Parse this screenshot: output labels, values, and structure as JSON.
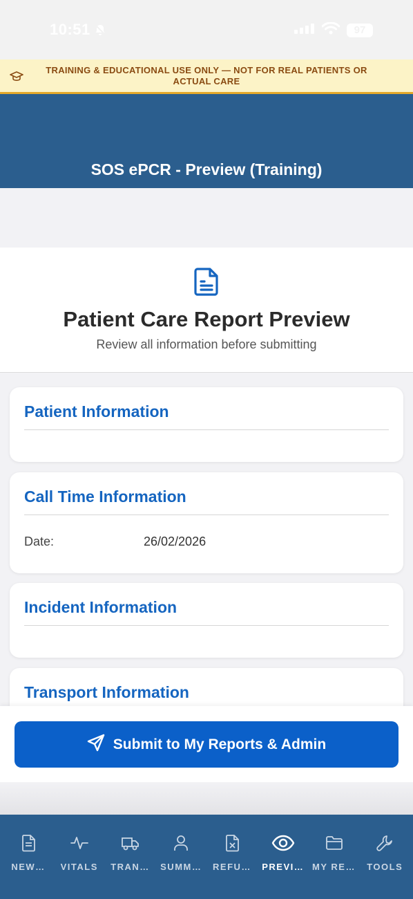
{
  "status_bar": {
    "time": "10:51",
    "battery": "97"
  },
  "banner": {
    "text": "TRAINING & EDUCATIONAL USE ONLY — NOT FOR REAL PATIENTS OR ACTUAL CARE",
    "icon": "graduation-cap-icon"
  },
  "header": {
    "title": "SOS ePCR - Preview (Training)"
  },
  "hero": {
    "icon": "document-icon",
    "title": "Patient Care Report Preview",
    "subtitle": "Review all information before submitting"
  },
  "sections": [
    {
      "title": "Patient Information"
    },
    {
      "title": "Call Time Information",
      "fields": [
        {
          "label": "Date:",
          "value": "26/02/2026"
        }
      ]
    },
    {
      "title": "Incident Information"
    },
    {
      "title": "Transport Information"
    }
  ],
  "submit": {
    "label": "Submit to My Reports & Admin",
    "icon": "send-icon"
  },
  "nav": {
    "items": [
      {
        "label": "NEW…",
        "icon": "document-icon"
      },
      {
        "label": "VITALS",
        "icon": "pulse-icon"
      },
      {
        "label": "TRAN…",
        "icon": "truck-icon"
      },
      {
        "label": "SUMM…",
        "icon": "person-icon"
      },
      {
        "label": "REFU…",
        "icon": "refusal-document-icon"
      },
      {
        "label": "PREVI…",
        "icon": "eye-icon"
      },
      {
        "label": "MY RE…",
        "icon": "folder-icon"
      },
      {
        "label": "TOOLS",
        "icon": "wrench-icon"
      }
    ],
    "active_index": 5
  },
  "colors": {
    "header": "#2b5e8e",
    "accent": "#1565c0",
    "button": "#0b60c9",
    "banner_bg": "#fcf3c7",
    "banner_text": "#8a4b12"
  }
}
